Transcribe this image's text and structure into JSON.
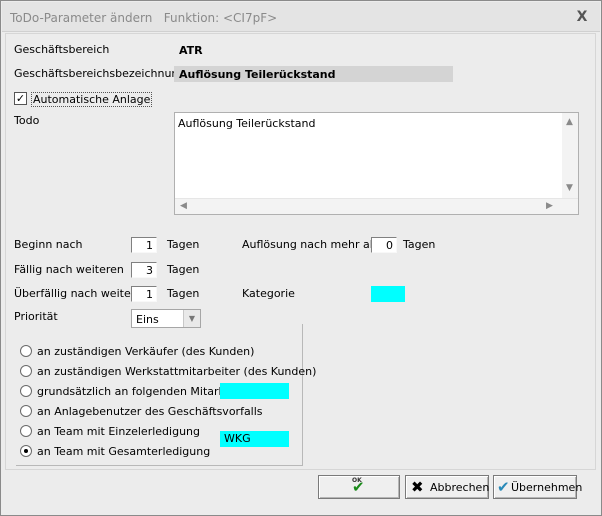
{
  "window": {
    "title": "ToDo-Parameter ändern   Funktion: <CI7pF>",
    "close_glyph": "X"
  },
  "form": {
    "geschaeftsbereich_label": "Geschäftsbereich",
    "geschaeftsbereich_value": "ATR",
    "bezeichnung_label": "Geschäftsbereichsbezeichnung",
    "bezeichnung_value": "Auflösung Teilerückstand",
    "automatische_anlage_label": "Automatische Anlage",
    "automatische_anlage_checked": true,
    "todo_label": "Todo",
    "todo_text": "Auflösung Teilerückstand",
    "beginn_label": "Beginn  nach",
    "beginn_value": "1",
    "faellig_label": "Fällig nach weiteren",
    "faellig_value": "3",
    "ueberfaellig_label": "Überfällig nach weiteren",
    "ueberfaellig_value": "1",
    "tagen_unit": "Tagen",
    "aufloesung_label": "Auflösung nach mehr als",
    "aufloesung_value": "0",
    "kategorie_label": "Kategorie",
    "kategorie_color": "#00ffff",
    "prioritaet_label": "Priorität",
    "prioritaet_value": "Eins"
  },
  "assignment": {
    "options": [
      {
        "label": "an zuständigen Verkäufer (des Kunden)",
        "selected": false
      },
      {
        "label": "an zuständigen Werkstattmitarbeiter (des Kunden)",
        "selected": false
      },
      {
        "label": "grundsätzlich an folgenden Mitarbeiter",
        "selected": false
      },
      {
        "label": "an Anlagebenutzer des Geschäftsvorfalls",
        "selected": false
      },
      {
        "label": "an Team mit Einzelerledigung",
        "selected": false
      },
      {
        "label": "an Team mit Gesamterledigung",
        "selected": true
      }
    ],
    "mitarbeiter_value": "",
    "team_value": "WKG"
  },
  "buttons": {
    "ok_label": "OK",
    "abbrechen_label": "Abbrechen",
    "uebernehmen_label": "Übernehmen"
  },
  "icons": {
    "ok": "ok-check-icon",
    "cancel": "x-cross-icon",
    "apply": "check-apply-icon",
    "close": "close-icon"
  }
}
